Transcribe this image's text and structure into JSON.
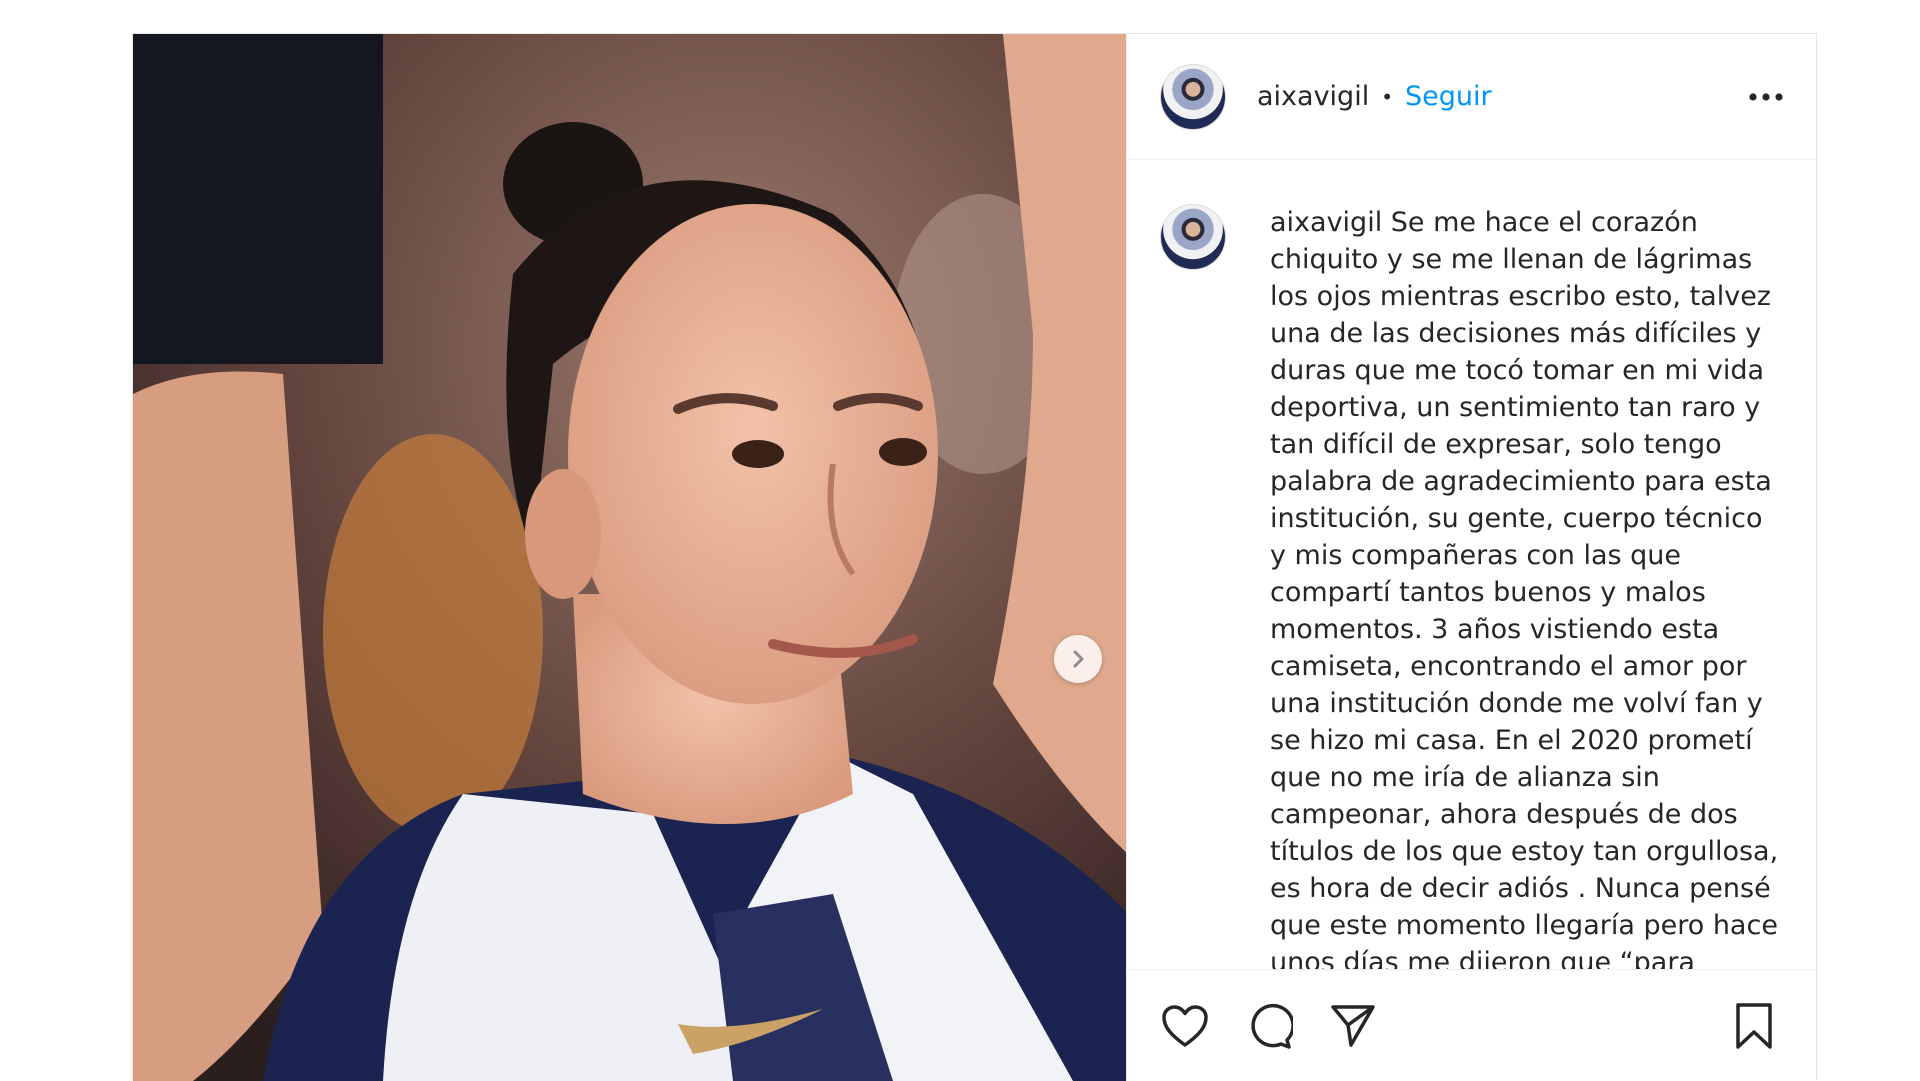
{
  "post": {
    "username": "aixavigil",
    "separator": "•",
    "follow_label": "Seguir",
    "more_icon": "more-horizontal-icon",
    "caption_username": "aixavigil",
    "caption_text": "Se me hace el corazón chiquito y se me llenan de lágrimas los ojos mientras escribo esto, talvez una de las decisiones más difíciles y duras que me tocó tomar en mi vida deportiva, un sentimiento tan raro y tan difícil de expresar, solo tengo palabra de agradecimiento para esta institución, su gente, cuerpo técnico y mis compañeras con las que compartí tantos buenos y malos momentos. 3 años vistiendo esta camiseta, encontrando el amor por una institución donde me volví fan y se hizo mi casa. En el 2020 prometí que no me iría de alianza sin campeonar, ahora después de dos títulos de los que estoy tan orgullosa, es hora de decir adiós . Nunca pensé que este momento llegaría pero hace unos días me dijeron que “para crecer hay que dejar algo atrás” y se que yo dejo mucho, no voy a seguir"
  },
  "actions": {
    "like_icon": "heart-icon",
    "comment_icon": "comment-icon",
    "share_icon": "share-icon",
    "save_icon": "bookmark-icon"
  },
  "media": {
    "next_icon": "chevron-right-icon"
  },
  "colors": {
    "link": "#0095f6",
    "text": "#262626",
    "border": "#efefef"
  }
}
